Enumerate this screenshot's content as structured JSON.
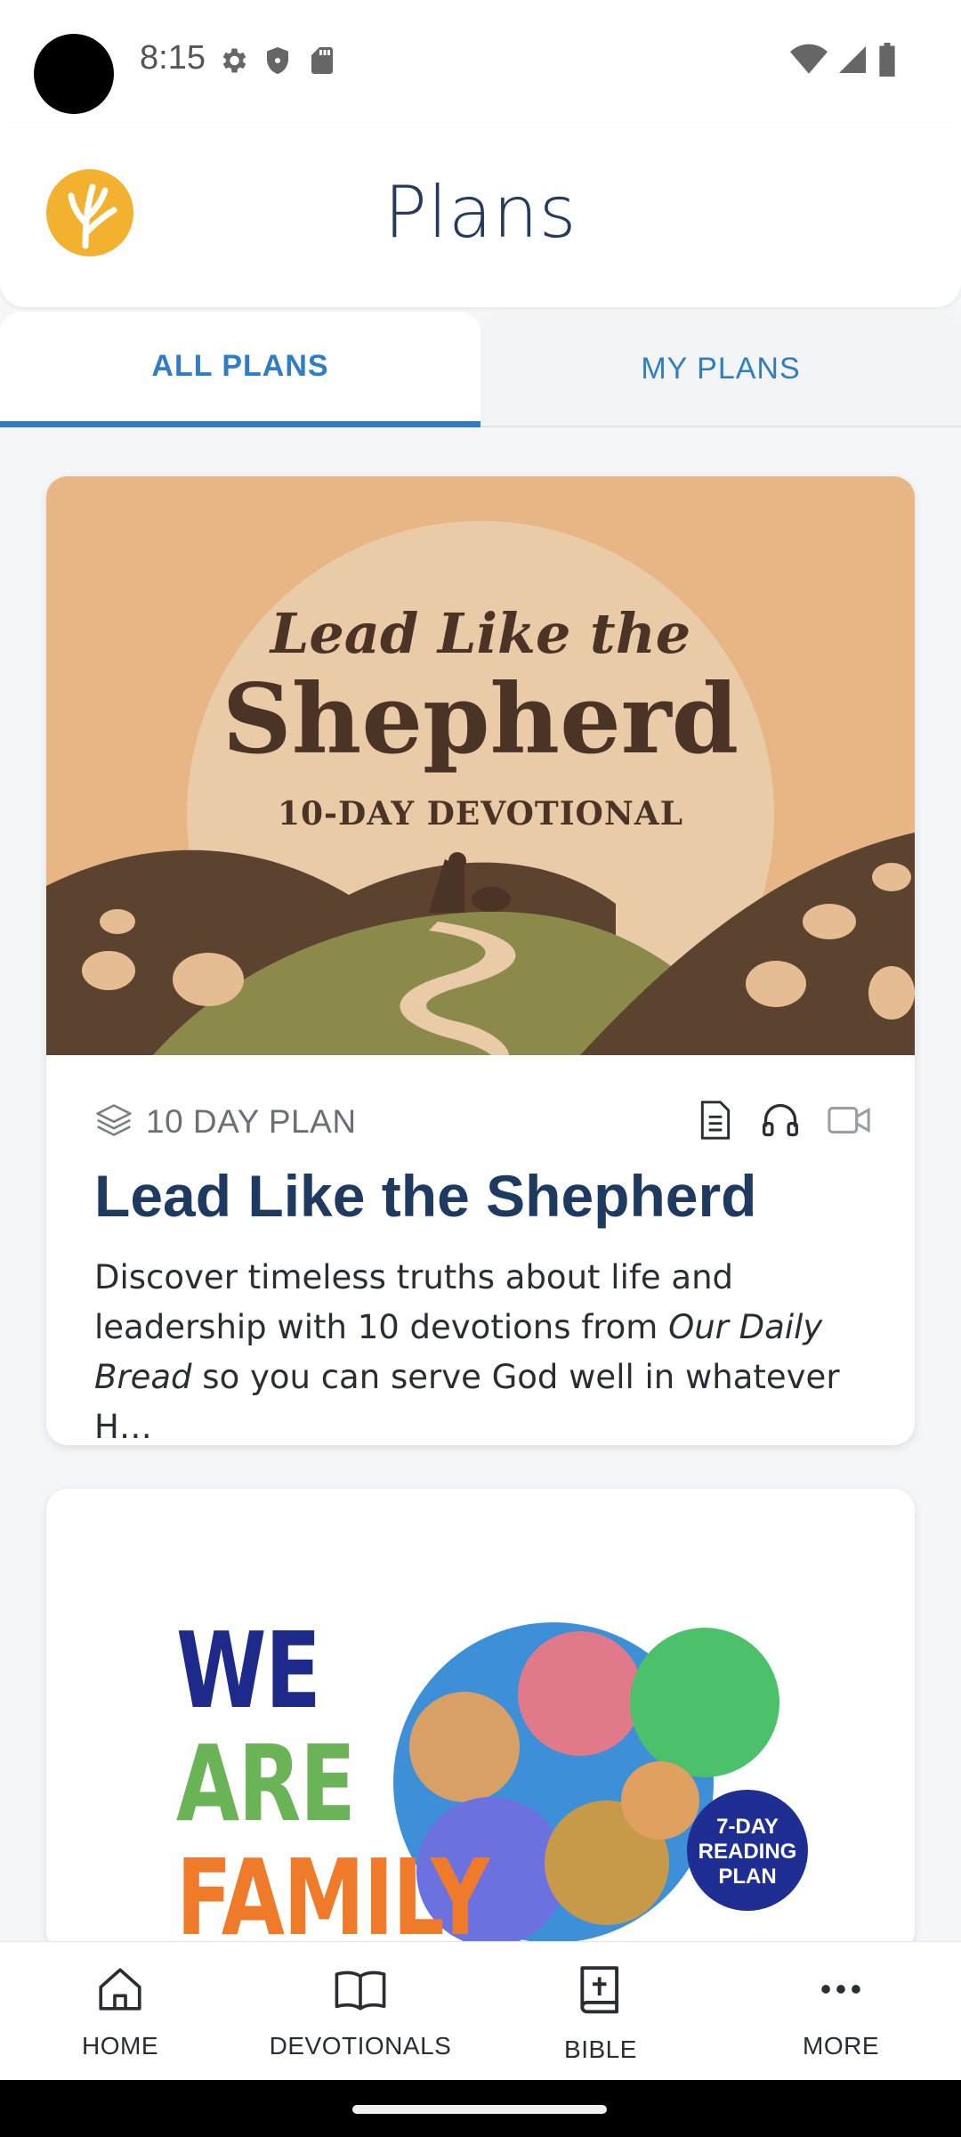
{
  "status_bar": {
    "time": "8:15",
    "left_icons": [
      "gear-icon",
      "shield-icon",
      "sd-card-icon"
    ],
    "right_icons": [
      "wifi-icon",
      "cell-signal-icon",
      "battery-icon"
    ]
  },
  "header": {
    "title": "Plans",
    "logo": "odb-logo"
  },
  "tabs": [
    {
      "label": "ALL PLANS",
      "active": true
    },
    {
      "label": "MY PLANS",
      "active": false
    }
  ],
  "cards": [
    {
      "hero": {
        "subtitle_top": "Lead Like the",
        "title": "Shepherd",
        "subtitle_bottom": "10-DAY DEVOTIONAL"
      },
      "plan_length": "10 DAY PLAN",
      "media_icons": [
        "document-icon",
        "headphones-icon",
        "video-icon"
      ],
      "title": "Lead Like the Shepherd",
      "description_part1": "Discover timeless truths about life and leadership with 10 devotions from ",
      "description_italic": "Our Daily Bread",
      "description_part2": " so you can serve God well in whatever H…"
    },
    {
      "hero": {
        "line1": "WE",
        "line2": "ARE",
        "line3": "FAMILY",
        "badge_line1": "7-DAY",
        "badge_line2": "READING",
        "badge_line3": "PLAN"
      }
    }
  ],
  "bottom_nav": [
    {
      "label": "HOME",
      "icon": "home-icon"
    },
    {
      "label": "DEVOTIONALS",
      "icon": "book-open-icon"
    },
    {
      "label": "BIBLE",
      "icon": "bible-icon"
    },
    {
      "label": "MORE",
      "icon": "more-icon"
    }
  ],
  "colors": {
    "accent": "#2f7ec4",
    "title": "#1f3a60",
    "logo": "#f3b130"
  }
}
